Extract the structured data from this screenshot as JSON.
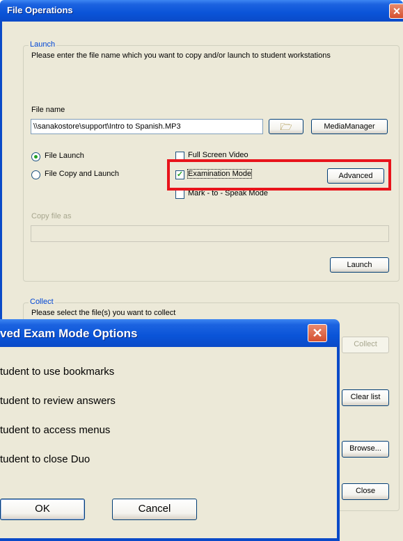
{
  "main_window": {
    "title": "File Operations",
    "launch_group": {
      "legend": "Launch",
      "instruction": "Please enter the file name which you want to copy and/or launch to student workstations",
      "file_name_label": "File name",
      "file_name_value": "\\\\sanakostore\\support\\Intro to Spanish.MP3",
      "browse_icon_label": "open-folder-icon",
      "media_manager_label": "MediaManager",
      "radio_file_launch": "File Launch",
      "radio_file_copy_launch": "File Copy and Launch",
      "check_full_screen": "Full Screen Video",
      "check_exam_mode": "Examination Mode",
      "advanced_label": "Advanced",
      "check_mark_speak": "Mark - to - Speak Mode",
      "copy_file_as_label": "Copy file as",
      "copy_file_as_value": "",
      "launch_label": "Launch"
    },
    "collect_group": {
      "legend": "Collect",
      "instruction_partial": "Please select the file(s) you want to collect",
      "collect_label": "Collect",
      "clear_list_label": "Clear list",
      "browse_label": "Browse..."
    },
    "close_label": "Close",
    "highlight_color": "#e8141b"
  },
  "dialog": {
    "title": "ved Exam Mode Options",
    "options": [
      "tudent to use bookmarks",
      "tudent to review answers",
      "tudent to access menus",
      "tudent to close Duo"
    ],
    "ok_label": "OK",
    "cancel_label": "Cancel"
  }
}
